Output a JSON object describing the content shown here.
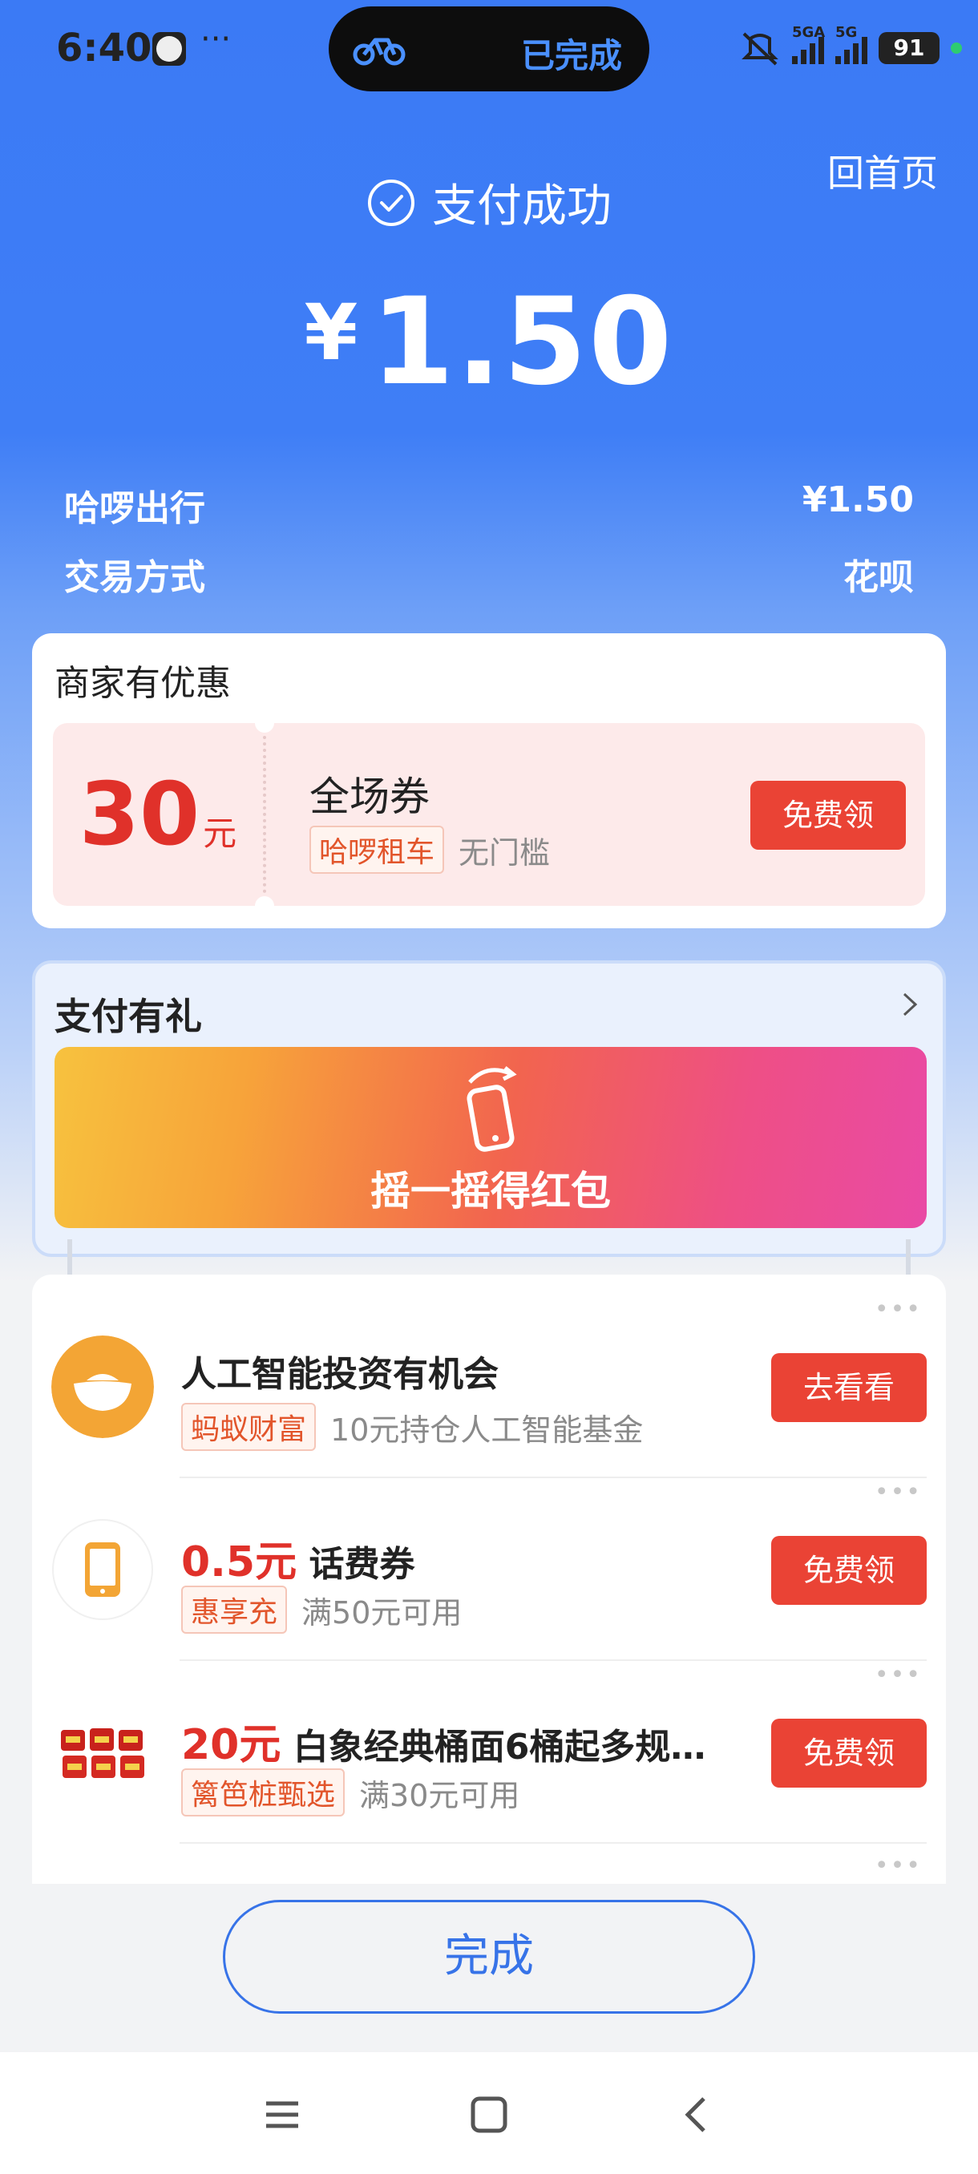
{
  "status_bar": {
    "time": "6:40",
    "dots": "···",
    "island_text": "已完成",
    "sig1_label": "5GA",
    "sig2_label": "5G",
    "battery": "91"
  },
  "header": {
    "home_link": "回首页",
    "success_text": "支付成功",
    "currency": "¥",
    "amount": "1.50"
  },
  "info": {
    "merchant_label": "哈啰出行",
    "merchant_value": "¥1.50",
    "method_label": "交易方式",
    "method_value": "花呗"
  },
  "coupon_section": {
    "title": "商家有优惠",
    "amount": "30",
    "unit": "元",
    "name": "全场券",
    "tag": "哈啰租车",
    "condition": "无门槛",
    "button": "免费领"
  },
  "gift_section": {
    "title": "支付有礼",
    "banner_text": "摇一摇得红包"
  },
  "list": [
    {
      "price": "",
      "title": "人工智能投资有机会",
      "tag": "蚂蚁财富",
      "desc": "10元持仓人工智能基金",
      "button": "去看看",
      "icon": "gold-ingot-icon"
    },
    {
      "price": "0.5元",
      "title": "话费券",
      "tag": "惠享充",
      "desc": "满50元可用",
      "button": "免费领",
      "icon": "phone-icon"
    },
    {
      "price": "20元",
      "title": "白象经典桶面6桶起多规…",
      "tag": "篱笆桩甄选",
      "desc": "满30元可用",
      "button": "免费领",
      "icon": "noodle-bowls-icon"
    }
  ],
  "done_button": "完成",
  "colors": {
    "brand_blue": "#3b7af5",
    "button_red": "#ea4335",
    "price_red": "#e0312a"
  }
}
